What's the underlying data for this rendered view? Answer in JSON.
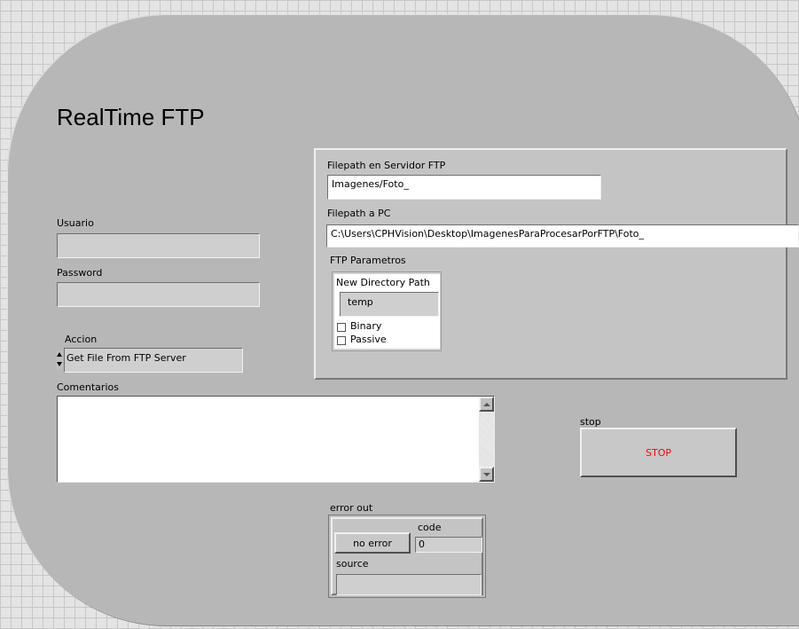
{
  "title": "RealTime FTP",
  "usuario": {
    "label": "Usuario",
    "value": ""
  },
  "password": {
    "label": "Password",
    "value": ""
  },
  "accion": {
    "label": "Accion",
    "value": "Get File From FTP Server"
  },
  "comentarios": {
    "label": "Comentarios",
    "value": ""
  },
  "ftp_box": {
    "servidor_label": "Filepath en Servidor FTP",
    "servidor_value": "Imagenes/Foto_",
    "pc_label": "Filepath a PC",
    "pc_value": "C:\\Users\\CPHVision\\Desktop\\ImagenesParaProcesarPorFTP\\Foto_",
    "parametros_label": "FTP Parametros",
    "new_dir_label": "New Directory Path",
    "new_dir_value": "temp",
    "binary_label": "Binary",
    "passive_label": "Passive"
  },
  "stop": {
    "label": "stop",
    "button": "STOP",
    "button_color": "#ff0000"
  },
  "error_out": {
    "label": "error out",
    "status": "no error",
    "code_label": "code",
    "code_value": "0",
    "source_label": "source",
    "source_value": ""
  }
}
